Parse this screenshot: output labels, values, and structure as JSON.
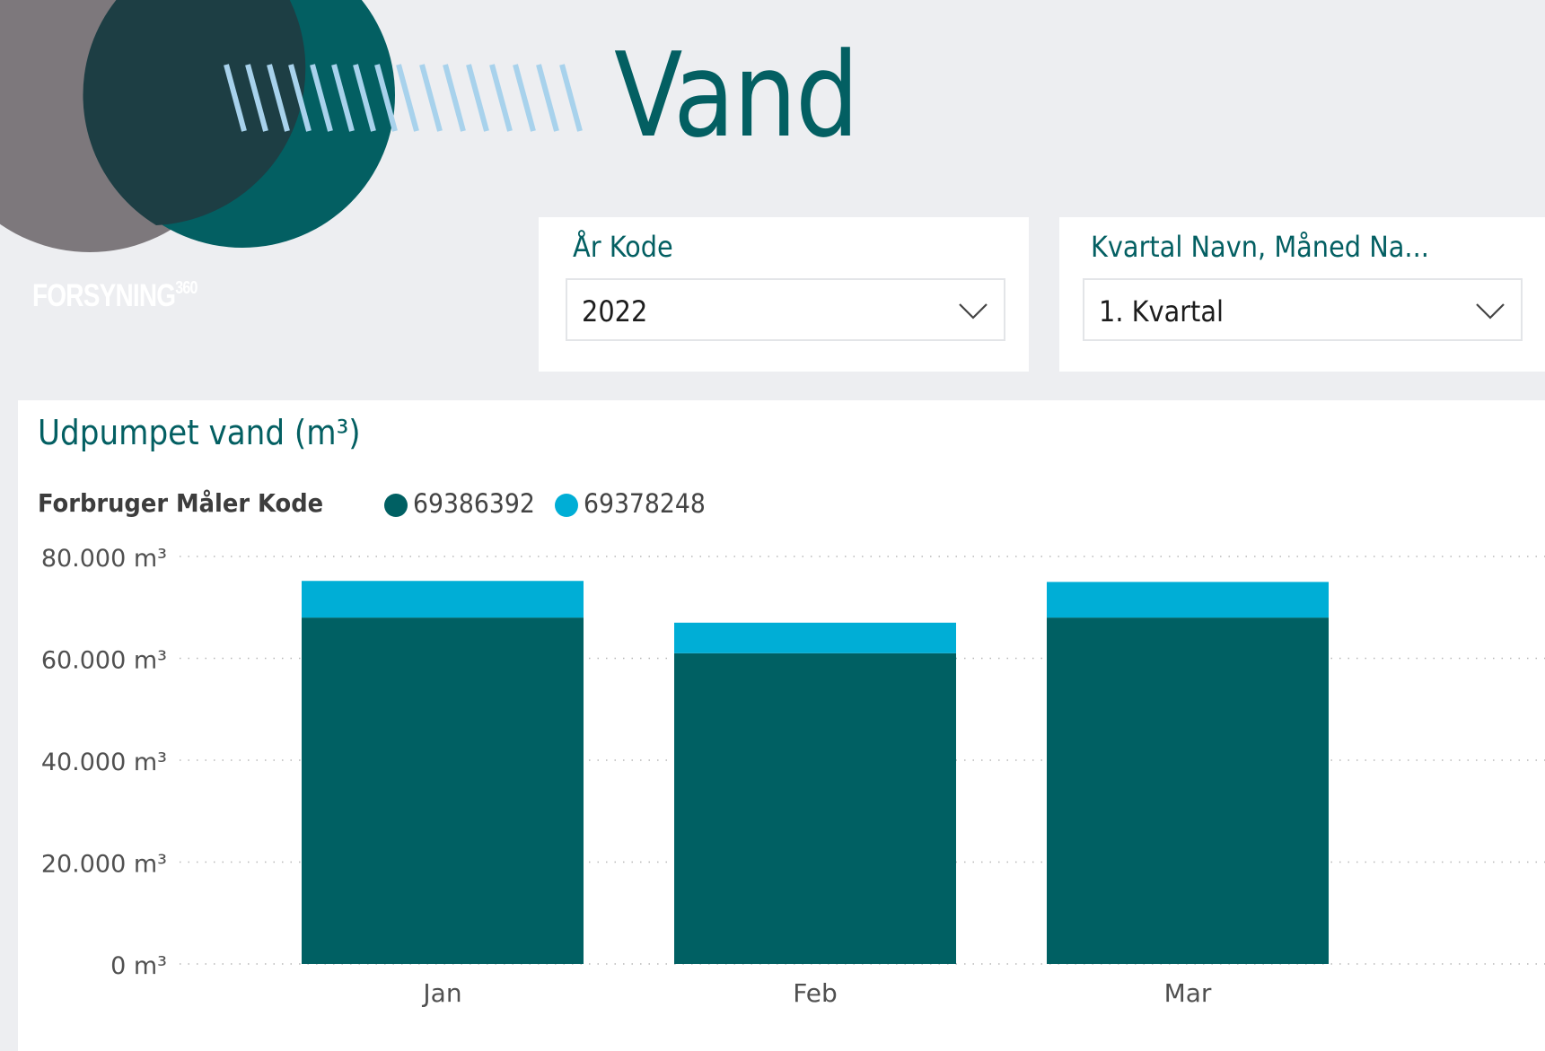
{
  "header": {
    "title": "Vand",
    "brand": "FORSYNING",
    "brand_suffix": "360"
  },
  "slicers": [
    {
      "label": "År Kode",
      "value": "2022"
    },
    {
      "label": "Kvartal Navn, Måned Na...",
      "value": "1. Kvartal"
    }
  ],
  "colors": {
    "accent": "#035f62",
    "series_dark": "#006063",
    "series_light": "#00aed6",
    "background": "#edeef1"
  },
  "chart": {
    "title": "Udpumpet vand (m³)",
    "legend_title": "Forbruger Måler Kode"
  },
  "chart_data": {
    "type": "bar",
    "stacked": true,
    "title": "Udpumpet vand (m³)",
    "legend_title": "Forbruger Måler Kode",
    "legend_position": "top-left",
    "categories": [
      "Jan",
      "Feb",
      "Mar"
    ],
    "series": [
      {
        "name": "69386392",
        "color": "#006063",
        "values": [
          68000,
          61000,
          68000
        ]
      },
      {
        "name": "69378248",
        "color": "#00aed6",
        "values": [
          7200,
          6000,
          7000
        ]
      }
    ],
    "ylim": [
      0,
      80000
    ],
    "yticks": [
      0,
      20000,
      40000,
      60000,
      80000
    ],
    "ytick_labels": [
      "0 m³",
      "20.000 m³",
      "40.000 m³",
      "60.000 m³",
      "80.000 m³"
    ],
    "grid": true
  }
}
